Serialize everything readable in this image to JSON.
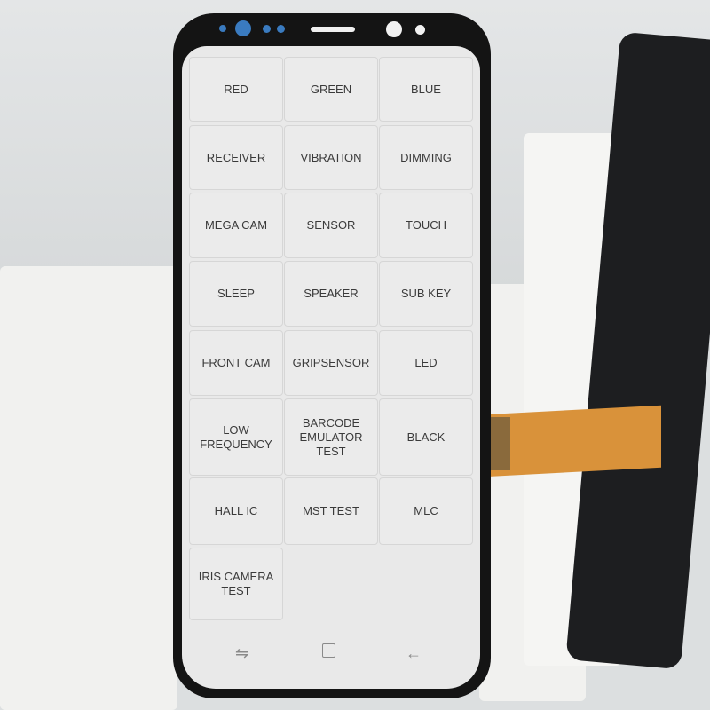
{
  "test_menu": {
    "items": [
      {
        "label": "RED"
      },
      {
        "label": "GREEN"
      },
      {
        "label": "BLUE"
      },
      {
        "label": "RECEIVER"
      },
      {
        "label": "VIBRATION"
      },
      {
        "label": "DIMMING"
      },
      {
        "label": "MEGA CAM"
      },
      {
        "label": "SENSOR"
      },
      {
        "label": "TOUCH"
      },
      {
        "label": "SLEEP"
      },
      {
        "label": "SPEAKER"
      },
      {
        "label": "SUB KEY"
      },
      {
        "label": "FRONT CAM"
      },
      {
        "label": "GRIPSENSOR"
      },
      {
        "label": "LED"
      },
      {
        "label": "LOW FREQUENCY"
      },
      {
        "label": "BARCODE\nEMULATOR TEST"
      },
      {
        "label": "BLACK"
      },
      {
        "label": "HALL IC"
      },
      {
        "label": "MST TEST"
      },
      {
        "label": "MLC"
      },
      {
        "label": "IRIS CAMERA\nTEST"
      }
    ]
  },
  "navbar": {
    "recents_icon": "recent-apps-icon",
    "home_icon": "home-icon",
    "back_icon": "back-arrow-icon"
  },
  "colors": {
    "sensor_blue": "#3a7bc0",
    "bezel": "#141414",
    "screen_bg": "#e9e9e9",
    "cable": "#d9923a"
  }
}
